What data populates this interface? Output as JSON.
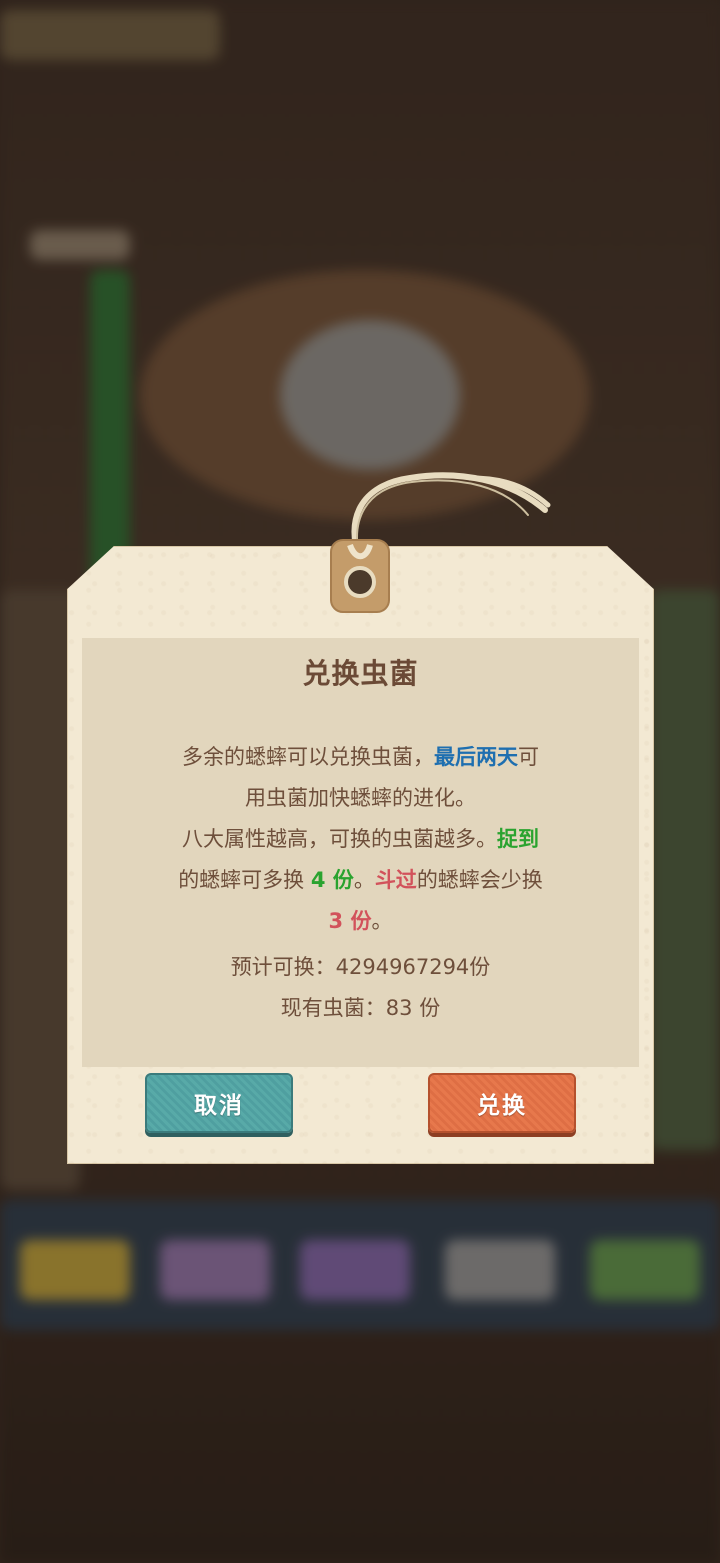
{
  "dialog": {
    "title": "兑换虫菌",
    "desc": {
      "p1": "多余的蟋蟀可以兑换虫菌，",
      "p1_highlight": "最后两天",
      "p1_tail": "可",
      "line2": "用虫菌加快蟋蟀的进化。",
      "line3": "八大属性越高，可换的虫菌越多。",
      "line3_highlight": "捉到",
      "line4_a": "的蟋蟀可多换 ",
      "line4_green": "4 份",
      "line4_b": "。",
      "line4_red": "斗过",
      "line4_c": "的蟋蟀会少换",
      "line5_red": "3 份",
      "line5_tail": "。"
    },
    "estimate": "预计可换：4294967294份",
    "owned": "现有虫菌：83 份",
    "cancel_label": "取消",
    "confirm_label": "兑换"
  },
  "colors": {
    "highlight_blue": "#1e6fb0",
    "highlight_green": "#2aa32f",
    "highlight_red": "#d2525b",
    "cancel_button": "#58aaa8",
    "confirm_button": "#e7784c"
  }
}
